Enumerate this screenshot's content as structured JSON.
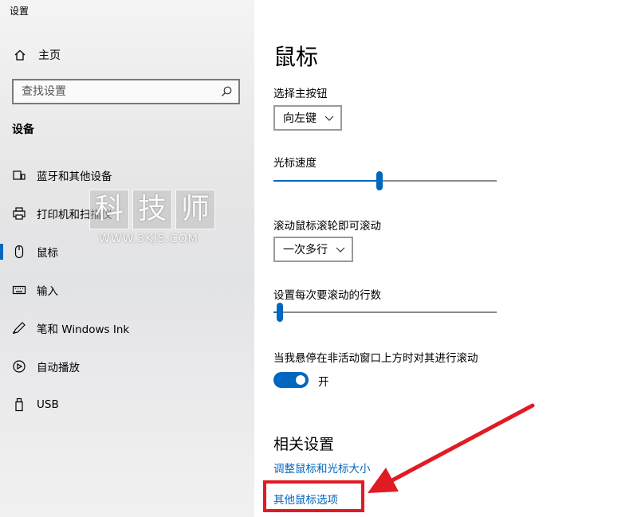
{
  "window": {
    "title": "设置"
  },
  "sidebar": {
    "home_label": "主页",
    "search_placeholder": "查找设置",
    "section_title": "设备",
    "items": [
      {
        "label": "蓝牙和其他设备",
        "icon": "bluetooth-devices-icon"
      },
      {
        "label": "打印机和扫描仪",
        "icon": "printer-icon"
      },
      {
        "label": "鼠标",
        "icon": "mouse-icon",
        "selected": true
      },
      {
        "label": "输入",
        "icon": "keyboard-icon"
      },
      {
        "label": "笔和 Windows Ink",
        "icon": "pen-icon"
      },
      {
        "label": "自动播放",
        "icon": "autoplay-icon"
      },
      {
        "label": "USB",
        "icon": "usb-icon"
      }
    ]
  },
  "watermark": {
    "chars": [
      "科",
      "技",
      "师"
    ],
    "url": "WWW.3KJS.COM"
  },
  "main": {
    "title": "鼠标",
    "primary_button": {
      "label": "选择主按钮",
      "value": "向左键"
    },
    "cursor_speed": {
      "label": "光标速度",
      "level": 0.475
    },
    "scroll_mode": {
      "label": "滚动鼠标滚轮即可滚动",
      "value": "一次多行"
    },
    "scroll_lines": {
      "label": "设置每次要滚动的行数",
      "level": 0.03
    },
    "inactive_scroll": {
      "label": "当我悬停在非活动窗口上方时对其进行滚动",
      "state": "开",
      "on": true
    },
    "related": {
      "title": "相关设置",
      "links": [
        "调整鼠标和光标大小",
        "其他鼠标选项"
      ]
    }
  },
  "colors": {
    "accent": "#0067c0",
    "annotation": "#e11b23"
  }
}
